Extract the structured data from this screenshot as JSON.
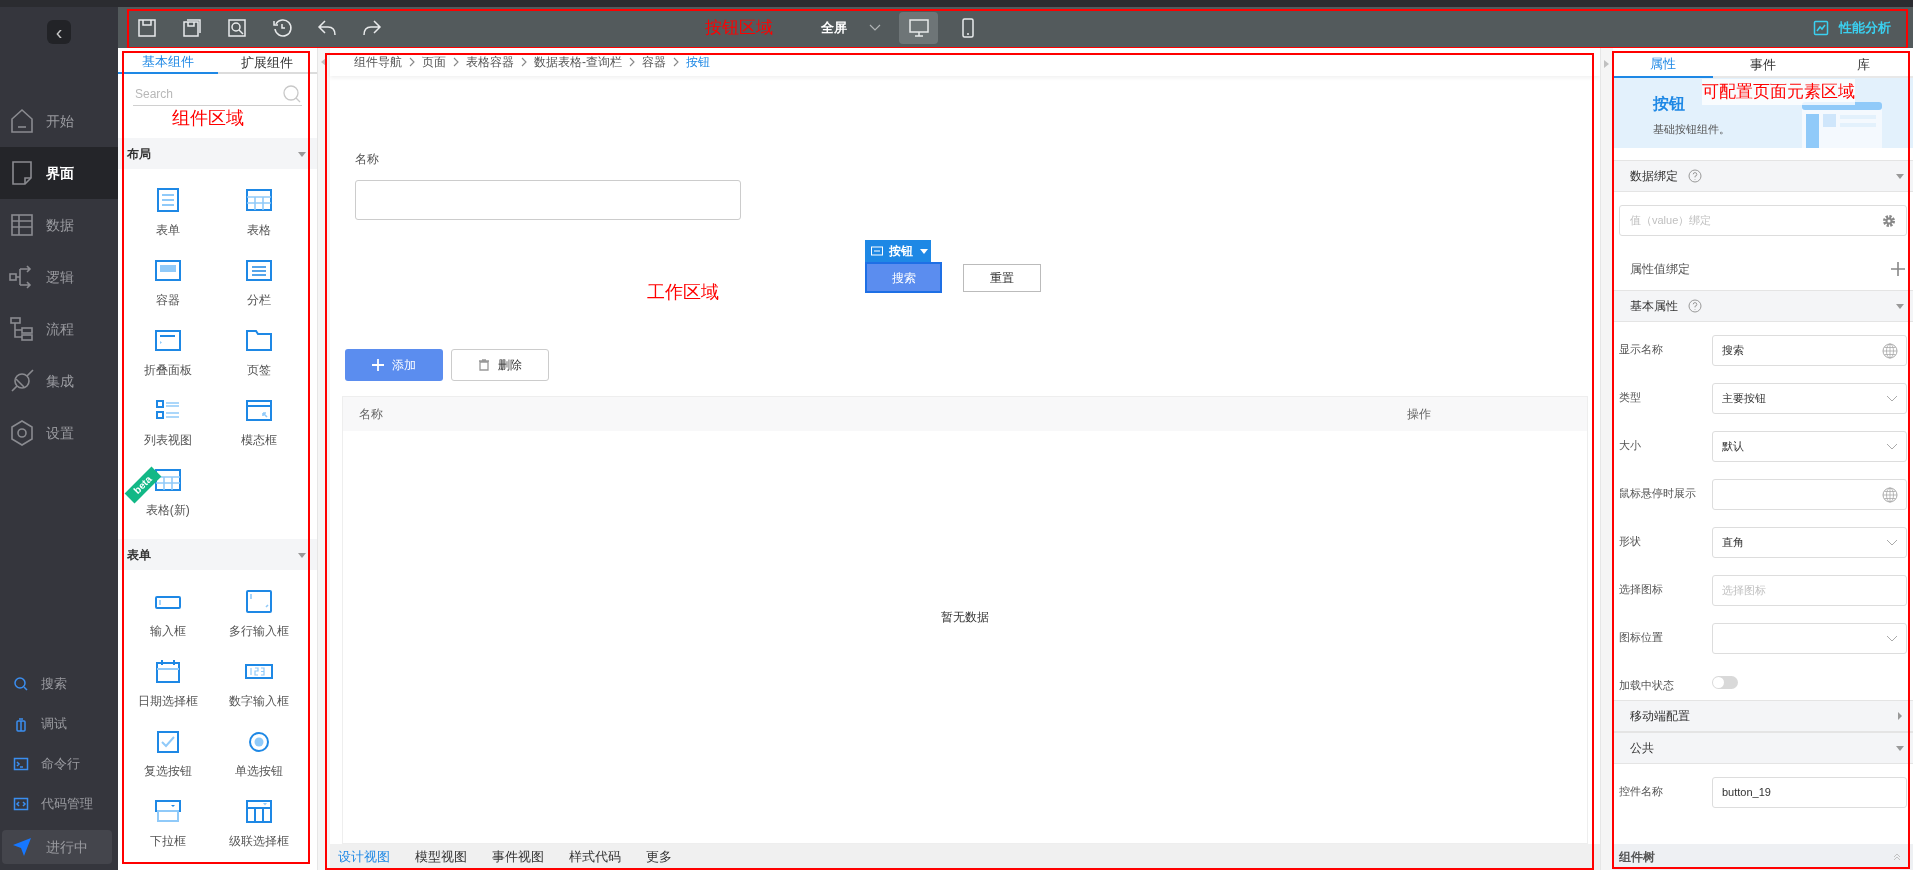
{
  "nav": {
    "back": "‹",
    "items": [
      {
        "label": "开始",
        "selected": false
      },
      {
        "label": "界面",
        "selected": true
      },
      {
        "label": "数据",
        "selected": false
      },
      {
        "label": "逻辑",
        "selected": false
      },
      {
        "label": "流程",
        "selected": false
      },
      {
        "label": "集成",
        "selected": false
      },
      {
        "label": "设置",
        "selected": false
      }
    ],
    "tools": [
      {
        "label": "搜索"
      },
      {
        "label": "调试"
      },
      {
        "label": "命令行"
      },
      {
        "label": "代码管理"
      }
    ],
    "status": "进行中"
  },
  "toolbar": {
    "annotation": "按钮区域",
    "screen_mode": "全屏",
    "devices": [
      {
        "selected": true
      },
      {
        "selected": false
      }
    ],
    "perf": "性能分析"
  },
  "component_panel": {
    "annotation": "组件区域",
    "tabs": [
      {
        "label": "基本组件",
        "selected": true
      },
      {
        "label": "扩展组件",
        "selected": false
      }
    ],
    "search": {
      "placeholder": "Search"
    },
    "groups": [
      {
        "title": "布局",
        "expanded": true,
        "items": [
          {
            "label": "表单"
          },
          {
            "label": "表格"
          },
          {
            "label": "容器"
          },
          {
            "label": "分栏"
          },
          {
            "label": "折叠面板"
          },
          {
            "label": "页签"
          },
          {
            "label": "列表视图"
          },
          {
            "label": "模态框"
          },
          {
            "label": "表格(新)",
            "badge": "beta"
          }
        ]
      },
      {
        "title": "表单",
        "expanded": true,
        "items": [
          {
            "label": "输入框"
          },
          {
            "label": "多行输入框"
          },
          {
            "label": "日期选择框"
          },
          {
            "label": "数字输入框"
          },
          {
            "label": "复选按钮"
          },
          {
            "label": "单选按钮"
          },
          {
            "label": "下拉框"
          },
          {
            "label": "级联选择框"
          }
        ]
      }
    ]
  },
  "workspace": {
    "annotation": "工作区域",
    "breadcrumb": [
      {
        "label": "组件导航",
        "current": false
      },
      {
        "label": "页面",
        "current": false
      },
      {
        "label": "表格容器",
        "current": false
      },
      {
        "label": "数据表格-查询栏",
        "current": false
      },
      {
        "label": "容器",
        "current": false
      },
      {
        "label": "按钮",
        "current": true
      }
    ],
    "form_label": "名称",
    "selection_tag": "按钮",
    "query_buttons": [
      {
        "label": "搜索",
        "selected": true
      },
      {
        "label": "重置",
        "selected": false
      }
    ],
    "actions": [
      {
        "label": "添加",
        "kind": "primary"
      },
      {
        "label": "删除",
        "kind": "default"
      }
    ],
    "table": {
      "columns": [
        "名称",
        "操作"
      ],
      "empty_text": "暂无数据"
    },
    "view_tabs": [
      {
        "label": "设计视图",
        "selected": true
      },
      {
        "label": "模型视图",
        "selected": false
      },
      {
        "label": "事件视图",
        "selected": false
      },
      {
        "label": "样式代码",
        "selected": false
      },
      {
        "label": "更多",
        "selected": false
      }
    ]
  },
  "properties": {
    "annotation": "可配置页面元素区域",
    "tabs": [
      {
        "label": "属性",
        "selected": true
      },
      {
        "label": "事件",
        "selected": false
      },
      {
        "label": "库",
        "selected": false
      }
    ],
    "banner": {
      "title": "按钮",
      "subtitle": "基础按钮组件。"
    },
    "sections": [
      {
        "title": "数据绑定",
        "help": true,
        "expanded": true,
        "rows": [
          {
            "kind": "binding",
            "placeholder": "值（value）绑定"
          },
          {
            "kind": "add",
            "label": "属性值绑定"
          }
        ]
      },
      {
        "title": "基本属性",
        "help": true,
        "expanded": true,
        "rows": [
          {
            "kind": "i18n",
            "label": "显示名称",
            "value": "搜索"
          },
          {
            "kind": "select",
            "label": "类型",
            "value": "主要按钮"
          },
          {
            "kind": "select",
            "label": "大小",
            "value": "默认"
          },
          {
            "kind": "i18n",
            "label": "鼠标悬停时展示"
          },
          {
            "kind": "select",
            "label": "形状",
            "value": "直角"
          },
          {
            "kind": "input",
            "label": "选择图标",
            "placeholder": "选择图标"
          },
          {
            "kind": "select",
            "label": "图标位置"
          },
          {
            "kind": "toggle",
            "label": "加载中状态",
            "on": false
          }
        ]
      },
      {
        "title": "移动端配置",
        "help": false,
        "expanded": false
      },
      {
        "title": "公共",
        "help": false,
        "expanded": true,
        "rows": [
          {
            "kind": "input",
            "label": "控件名称",
            "value": "button_19"
          }
        ]
      }
    ],
    "tree_bar": "组件树"
  }
}
